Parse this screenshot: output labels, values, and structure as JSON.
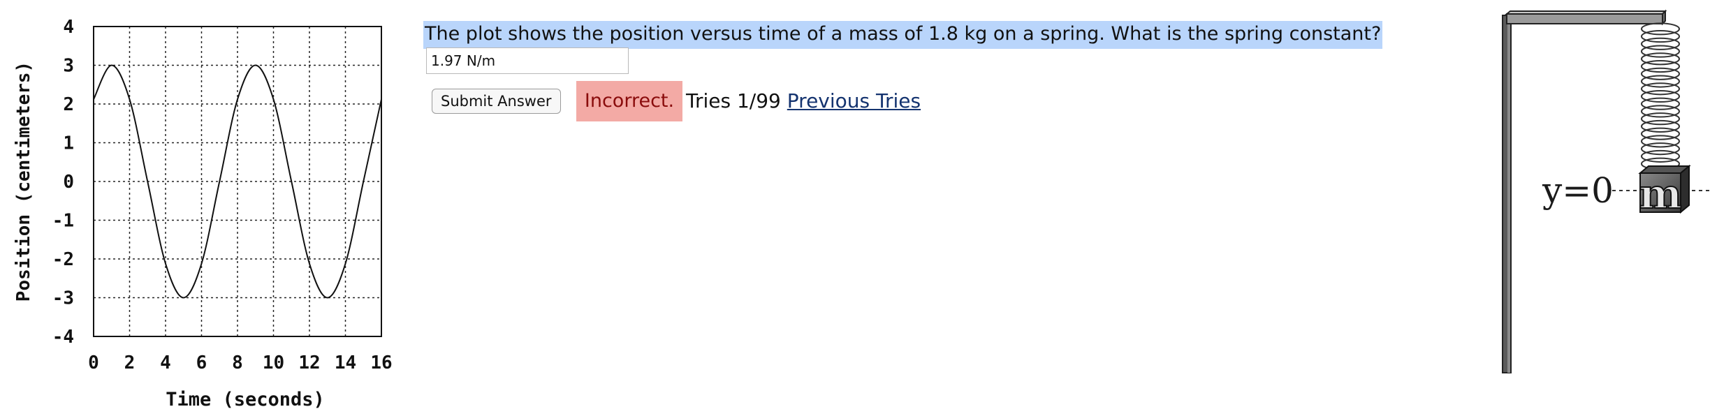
{
  "question": {
    "text": "The plot shows the position versus time of a mass of 1.8 kg on a spring. What is the spring constant?"
  },
  "answer": {
    "value": "1.97 N/m"
  },
  "submit": {
    "label": "Submit Answer"
  },
  "status": {
    "text": "Incorrect.",
    "color": "#f3aaa5"
  },
  "tries": {
    "text": "Tries 1/99",
    "link": "Previous Tries"
  },
  "diagram": {
    "y_label": "y=0",
    "mass_label": "m"
  },
  "chart_data": {
    "type": "line",
    "xlabel": "Time (seconds)",
    "ylabel": "Position (centimeters)",
    "xlim": [
      0,
      16
    ],
    "ylim": [
      -4,
      4
    ],
    "xticks": [
      "0",
      "2",
      "4",
      "6",
      "8",
      "10",
      "12",
      "14",
      "16"
    ],
    "yticks": [
      "4",
      "3",
      "2",
      "1",
      "0",
      "-1",
      "-2",
      "-3",
      "-4"
    ],
    "grid": true,
    "series": [
      {
        "x": [
          0,
          1,
          2,
          3,
          4,
          5,
          6,
          7,
          8,
          9,
          10,
          11,
          12,
          13,
          14,
          15,
          16
        ],
        "y": [
          2.12,
          3.0,
          2.12,
          0,
          -2.12,
          -3.0,
          -2.12,
          0,
          2.12,
          3.0,
          2.12,
          0,
          -2.12,
          -3.0,
          -2.12,
          0,
          2.12
        ]
      }
    ]
  }
}
